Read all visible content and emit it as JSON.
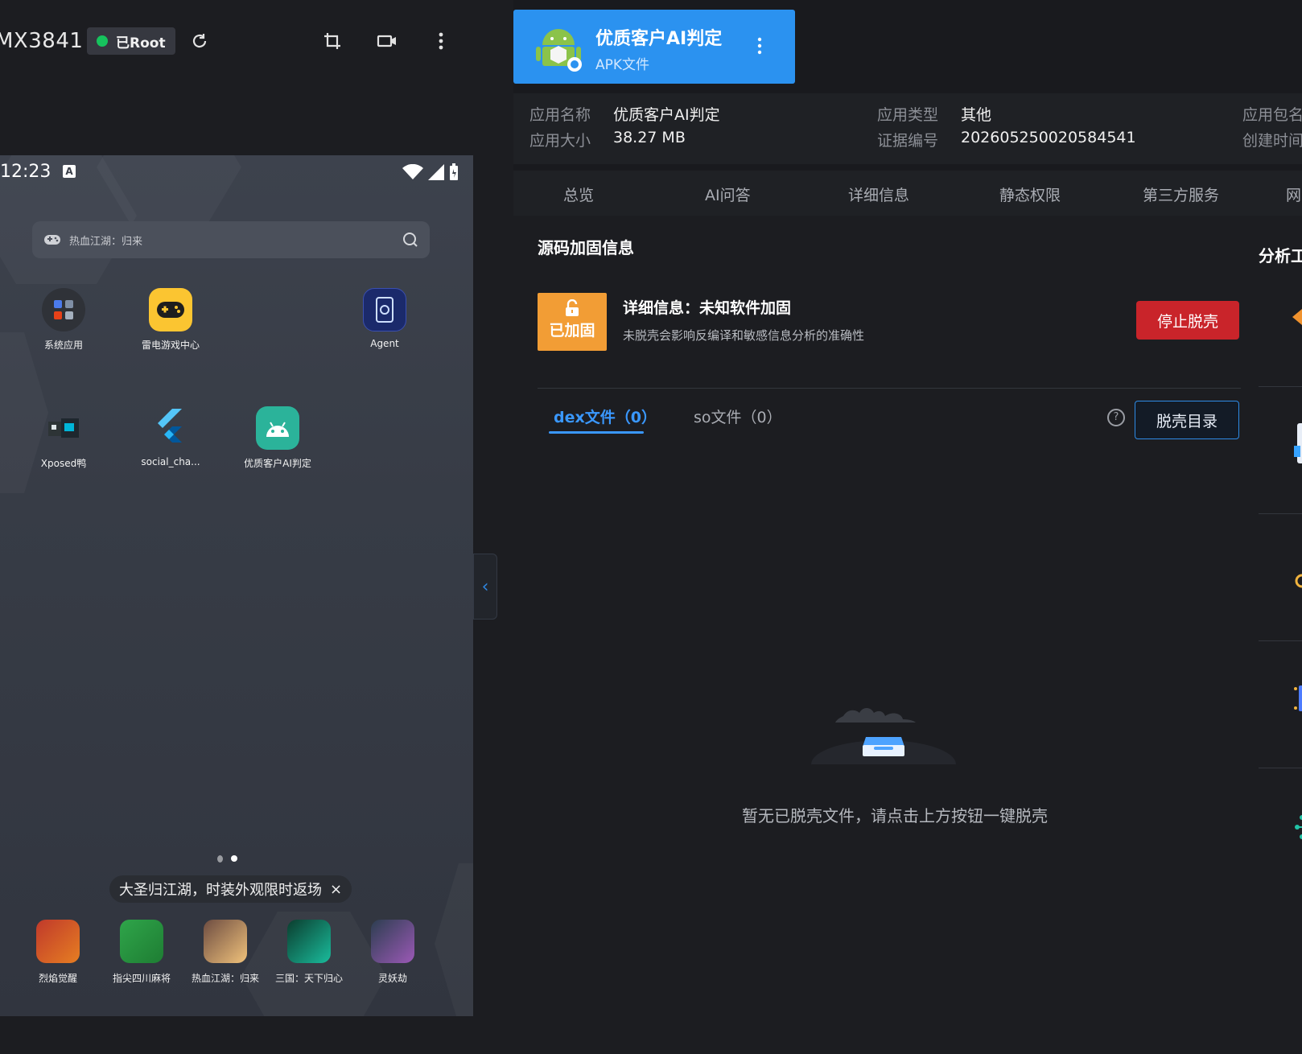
{
  "device": {
    "title": "MX3841",
    "root_badge": "已Root",
    "status_time": "12:23",
    "status_a": "A",
    "search_placeholder": "热血江湖：归来",
    "apps": [
      {
        "label": "系统应用"
      },
      {
        "label": "雷电游戏中心"
      },
      {
        "label": "Agent"
      },
      {
        "label": "Xposed鸭"
      },
      {
        "label": "social_cha..."
      },
      {
        "label": "优质客户AI判定"
      }
    ],
    "toast": "大圣归江湖，时装外观限时返场",
    "toast_close": "×",
    "dock": [
      {
        "label": "烈焰觉醒",
        "color": "#c0392b"
      },
      {
        "label": "指尖四川麻将",
        "color": "#2fa54a"
      },
      {
        "label": "热血江湖：归来",
        "color": "#c98a5a"
      },
      {
        "label": "三国：天下归心",
        "color": "#1d5e4a"
      },
      {
        "label": "灵妖劫",
        "color": "#7a5aa8"
      }
    ],
    "collapse_icon": "‹"
  },
  "appcard": {
    "name": "优质客户AI判定",
    "type": "APK文件",
    "more": "⋮"
  },
  "info": {
    "name_label": "应用名称",
    "name_value": "优质客户AI判定",
    "size_label": "应用大小",
    "size_value": "38.27 MB",
    "type_label": "应用类型",
    "type_value": "其他",
    "evidence_label": "证据编号",
    "evidence_value": "202605250020584541",
    "package_label": "应用包名",
    "created_label": "创建时间"
  },
  "tabs": [
    "总览",
    "AI问答",
    "详细信息",
    "静态权限",
    "第三方服务",
    "网"
  ],
  "section": {
    "title": "源码加固信息",
    "lock_label": "已加固",
    "detail_title": "详细信息：未知软件加固",
    "detail_sub": "未脱壳会影响反编译和敏感信息分析的准确性",
    "stop_button": "停止脱壳",
    "subtabs": [
      "dex文件（0）",
      "so文件（0）"
    ],
    "help": "?",
    "shell_dir_button": "脱壳目录",
    "empty_text": "暂无已脱壳文件，请点击上方按钮一键脱壳"
  },
  "side": {
    "title": "分析工"
  },
  "colors": {
    "accent": "#2b92f0",
    "danger": "#c9242a",
    "warning": "#f29d35",
    "tab_active": "#3a98ff"
  }
}
